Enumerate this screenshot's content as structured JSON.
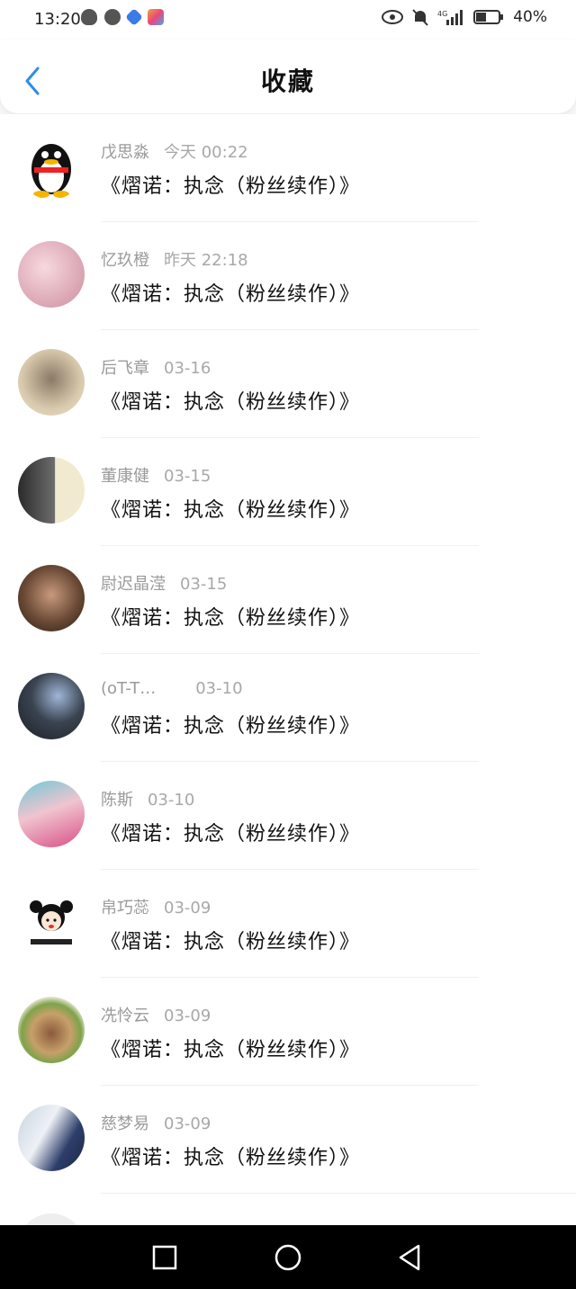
{
  "status": {
    "time": "13:20",
    "battery": "40%"
  },
  "header": {
    "title": "收藏"
  },
  "items": [
    {
      "name": "戊思淼",
      "time": "今天 00:22",
      "title": "《熠诺：执念（粉丝续作）》"
    },
    {
      "name": "忆玖橙",
      "time": "昨天 22:18",
      "title": "《熠诺：执念（粉丝续作）》"
    },
    {
      "name": "后飞章",
      "time": "03-16",
      "title": "《熠诺：执念（粉丝续作）》"
    },
    {
      "name": "董康健",
      "time": "03-15",
      "title": "《熠诺：执念（粉丝续作）》"
    },
    {
      "name": "尉迟晶滢",
      "time": "03-15",
      "title": "《熠诺：执念（粉丝续作）》"
    },
    {
      "name": "(oT-T…",
      "time": "03-10",
      "title": "《熠诺：执念（粉丝续作）》"
    },
    {
      "name": "陈斯",
      "time": "03-10",
      "title": "《熠诺：执念（粉丝续作）》"
    },
    {
      "name": "帛巧蕊",
      "time": "03-09",
      "title": "《熠诺：执念（粉丝续作）》"
    },
    {
      "name": "冼怜云",
      "time": "03-09",
      "title": "《熠诺：执念（粉丝续作）》"
    },
    {
      "name": "慈梦易",
      "time": "03-09",
      "title": "《熠诺：执念（粉丝续作）》"
    }
  ],
  "colors": {
    "accent": "#2f8ce8"
  }
}
